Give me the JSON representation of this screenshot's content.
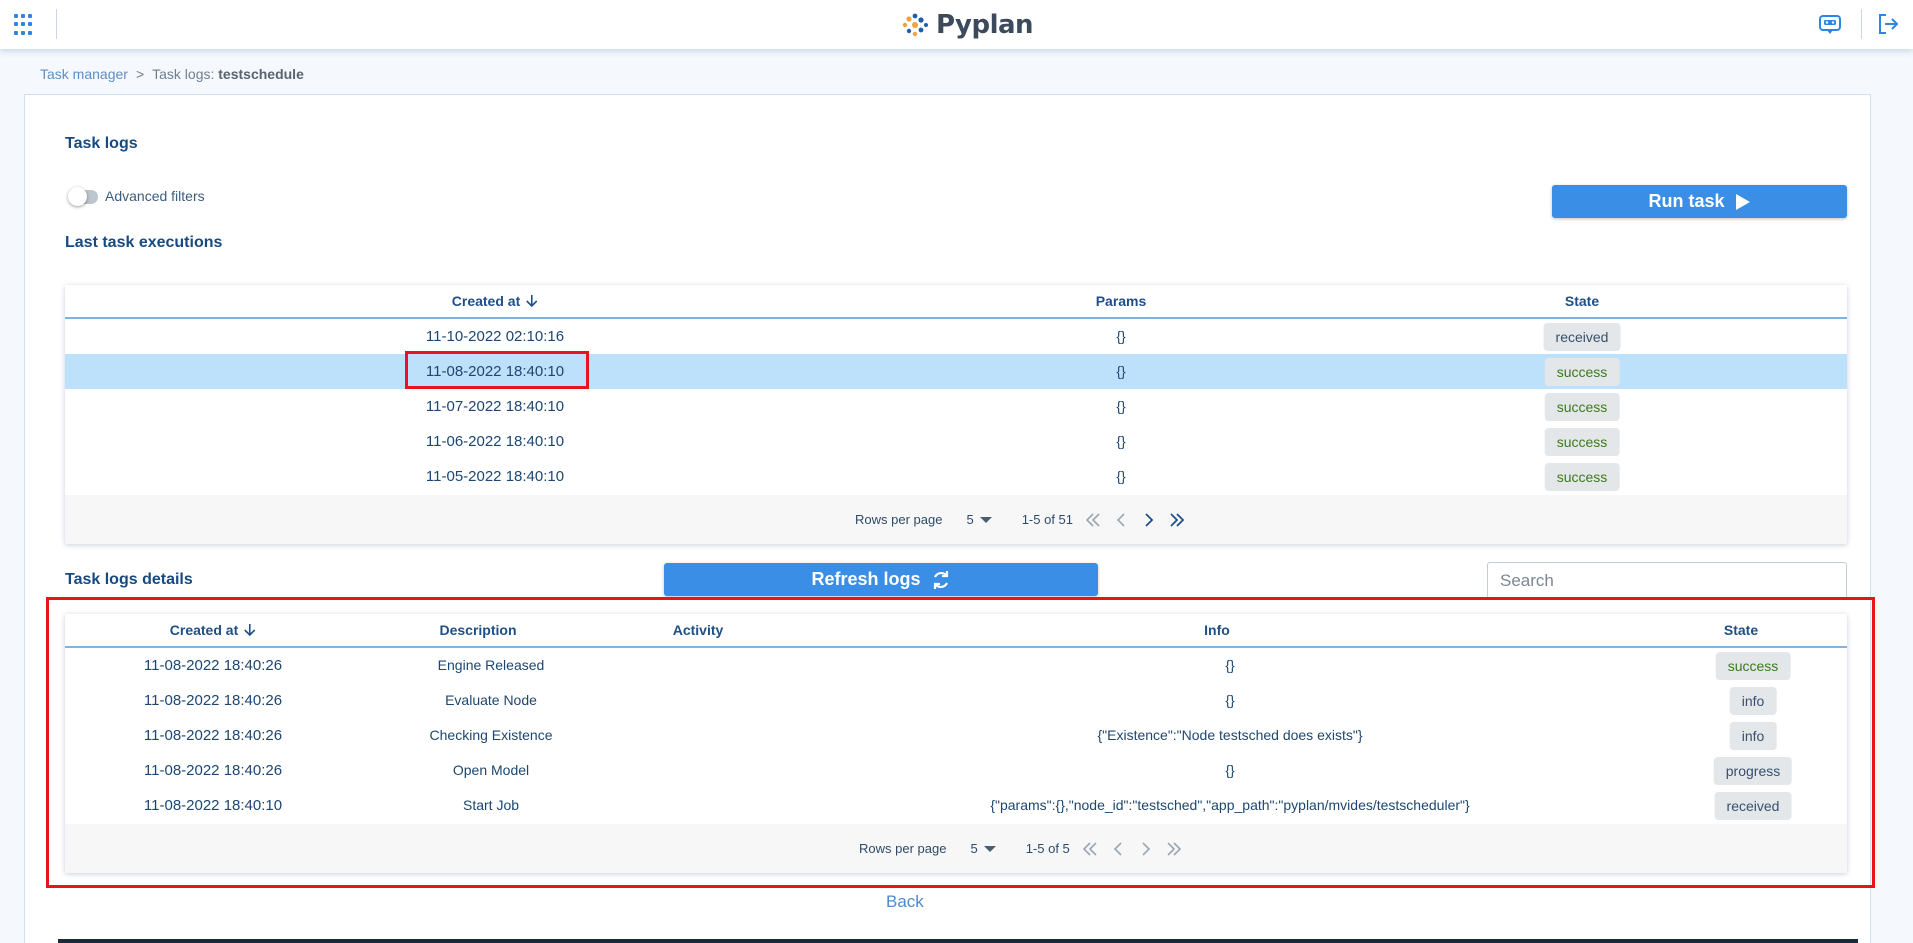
{
  "header": {
    "app_name": "Pyplan"
  },
  "breadcrumb": {
    "root": "Task manager",
    "separator": ">",
    "current_prefix": "Task logs:",
    "current_name": "testschedule"
  },
  "page": {
    "title": "Task logs",
    "advanced_filters_label": "Advanced filters",
    "run_task_label": "Run task",
    "last_executions_title": "Last task executions",
    "details_title": "Task logs details",
    "refresh_label": "Refresh logs",
    "search_placeholder": "Search",
    "back_label": "Back"
  },
  "executions": {
    "columns": {
      "created_at": "Created at",
      "params": "Params",
      "state": "State"
    },
    "rows": [
      {
        "created_at": "11-10-2022 02:10:16",
        "params": "{}",
        "state": "received",
        "selected": false
      },
      {
        "created_at": "11-08-2022 18:40:10",
        "params": "{}",
        "state": "success",
        "selected": true
      },
      {
        "created_at": "11-07-2022 18:40:10",
        "params": "{}",
        "state": "success",
        "selected": false
      },
      {
        "created_at": "11-06-2022 18:40:10",
        "params": "{}",
        "state": "success",
        "selected": false
      },
      {
        "created_at": "11-05-2022 18:40:10",
        "params": "{}",
        "state": "success",
        "selected": false
      }
    ],
    "footer": {
      "rows_per_page_label": "Rows per page",
      "rows_per_page": "5",
      "range": "1-5 of 51"
    }
  },
  "details": {
    "columns": {
      "created_at": "Created at",
      "description": "Description",
      "activity": "Activity",
      "info": "Info",
      "state": "State"
    },
    "rows": [
      {
        "created_at": "11-08-2022 18:40:26",
        "description": "Engine Released",
        "activity": "",
        "info": "{}",
        "state": "success"
      },
      {
        "created_at": "11-08-2022 18:40:26",
        "description": "Evaluate Node",
        "activity": "",
        "info": "{}",
        "state": "info"
      },
      {
        "created_at": "11-08-2022 18:40:26",
        "description": "Checking Existence",
        "activity": "",
        "info": "{\"Existence\":\"Node testsched does exists\"}",
        "state": "info"
      },
      {
        "created_at": "11-08-2022 18:40:26",
        "description": "Open Model",
        "activity": "",
        "info": "{}",
        "state": "progress"
      },
      {
        "created_at": "11-08-2022 18:40:10",
        "description": "Start Job",
        "activity": "",
        "info": "{\"params\":{},\"node_id\":\"testsched\",\"app_path\":\"pyplan/mvides/testscheduler\"}",
        "state": "received"
      }
    ],
    "footer": {
      "rows_per_page_label": "Rows per page",
      "rows_per_page": "5",
      "range": "1-5 of 5"
    }
  },
  "colors": {
    "accent": "#3a8ee6",
    "highlight": "#e8141c",
    "selected_row": "#bde0fb",
    "success_text": "#3b7a1a"
  }
}
